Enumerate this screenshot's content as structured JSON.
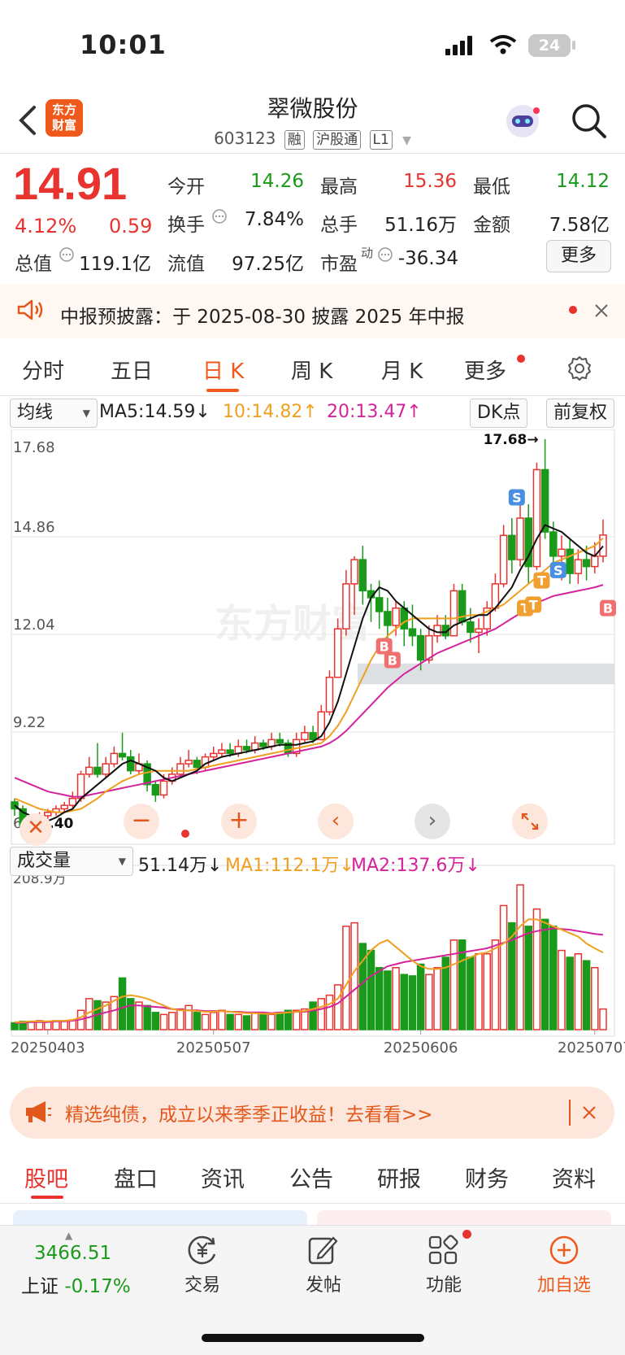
{
  "status_bar": {
    "time": "10:01",
    "battery": "24"
  },
  "header": {
    "logo_text_line1": "东方",
    "logo_text_line2": "财富",
    "stock_name": "翠微股份",
    "stock_code": "603123",
    "tags": [
      "融",
      "沪股通",
      "L1"
    ]
  },
  "quote": {
    "price": "14.91",
    "change_pct": "4.12%",
    "change": "0.59",
    "stats": [
      {
        "label": "今开",
        "value": "14.26",
        "color": "green"
      },
      {
        "label": "最高",
        "value": "15.36",
        "color": "red"
      },
      {
        "label": "最低",
        "value": "14.12",
        "color": "green"
      },
      {
        "label": "换手",
        "value": "7.84%",
        "color": "black"
      },
      {
        "label": "总手",
        "value": "51.16万",
        "color": "black"
      },
      {
        "label": "金额",
        "value": "7.58亿",
        "color": "black"
      },
      {
        "label": "总值",
        "value": "119.1亿",
        "color": "black"
      },
      {
        "label": "流值",
        "value": "97.25亿",
        "color": "black"
      },
      {
        "label": "市盈",
        "value": "-36.34",
        "color": "black",
        "superscript": "动"
      }
    ],
    "more_button": "更多"
  },
  "notice": {
    "text": "中报预披露：于 2025-08-30 披露 2025 年中报"
  },
  "chart_tabs": [
    "分时",
    "五日",
    "日 K",
    "周 K",
    "月 K",
    "更多"
  ],
  "active_chart_tab": "日 K",
  "ma_bar": {
    "selector": "均线",
    "ma5": "MA5:14.59",
    "ma10": "10:14.82",
    "ma20": "20:13.47",
    "dk_button": "DK点",
    "adjust_button": "前复权",
    "arrow_down": "↓",
    "arrow_up": "↑"
  },
  "volume_bar": {
    "selector": "成交量",
    "value": "51.14万",
    "ma1": "MA1:112.1万",
    "ma2": "MA2:137.6万",
    "arrow": "↓"
  },
  "chart_data": {
    "type": "candlestick",
    "price_axis_ticks": [
      "17.68",
      "14.86",
      "12.04",
      "9.22",
      "6.40"
    ],
    "ylim": [
      6.4,
      17.68
    ],
    "max_label": "17.68",
    "min_label": "6.40",
    "x_ticks": [
      "20250403",
      "20250507",
      "20250606",
      "20250707"
    ],
    "volume_axis_label": "208.9万",
    "candles": [
      [
        7.2,
        7.0,
        7.3,
        6.8
      ],
      [
        7.0,
        6.5,
        7.1,
        6.4
      ],
      [
        6.5,
        6.6,
        6.8,
        6.45
      ],
      [
        6.6,
        6.8,
        6.9,
        6.5
      ],
      [
        6.8,
        6.9,
        7.0,
        6.7
      ],
      [
        6.9,
        7.0,
        7.1,
        6.8
      ],
      [
        7.0,
        7.1,
        7.2,
        6.9
      ],
      [
        7.1,
        7.3,
        7.5,
        7.0
      ],
      [
        7.3,
        8.0,
        8.1,
        7.2
      ],
      [
        8.0,
        8.2,
        8.5,
        7.9
      ],
      [
        8.2,
        8.0,
        8.9,
        7.9
      ],
      [
        8.0,
        8.3,
        8.5,
        7.9
      ],
      [
        8.3,
        8.6,
        8.8,
        8.2
      ],
      [
        8.6,
        8.5,
        9.2,
        8.4
      ],
      [
        8.5,
        8.1,
        8.7,
        8.0
      ],
      [
        8.1,
        8.3,
        8.6,
        8.0
      ],
      [
        8.3,
        7.7,
        8.4,
        7.5
      ],
      [
        7.7,
        7.4,
        7.8,
        7.2
      ],
      [
        7.4,
        7.8,
        8.0,
        7.3
      ],
      [
        7.8,
        8.0,
        8.2,
        7.7
      ],
      [
        8.0,
        8.3,
        8.5,
        7.9
      ],
      [
        8.3,
        8.4,
        8.7,
        8.2
      ],
      [
        8.4,
        8.2,
        8.5,
        8.0
      ],
      [
        8.2,
        8.5,
        8.6,
        8.1
      ],
      [
        8.5,
        8.6,
        8.8,
        8.4
      ],
      [
        8.6,
        8.7,
        8.9,
        8.5
      ],
      [
        8.7,
        8.6,
        8.9,
        8.5
      ],
      [
        8.6,
        8.8,
        9.0,
        8.5
      ],
      [
        8.8,
        8.7,
        9.0,
        8.6
      ],
      [
        8.7,
        8.9,
        9.1,
        8.6
      ],
      [
        8.9,
        8.8,
        9.0,
        8.7
      ],
      [
        8.8,
        9.0,
        9.2,
        8.7
      ],
      [
        9.0,
        8.9,
        9.2,
        8.8
      ],
      [
        8.9,
        8.6,
        9.0,
        8.5
      ],
      [
        8.6,
        9.0,
        9.2,
        8.5
      ],
      [
        9.0,
        9.2,
        9.4,
        8.9
      ],
      [
        9.2,
        9.0,
        9.4,
        8.9
      ],
      [
        9.0,
        9.8,
        10.0,
        9.0
      ],
      [
        9.8,
        10.8,
        11.0,
        9.7
      ],
      [
        10.8,
        12.2,
        12.5,
        10.8
      ],
      [
        12.2,
        13.5,
        13.9,
        12.0
      ],
      [
        13.5,
        14.2,
        14.3,
        12.6
      ],
      [
        14.2,
        13.3,
        14.6,
        12.9
      ],
      [
        13.3,
        13.1,
        13.5,
        12.4
      ],
      [
        13.1,
        12.7,
        13.6,
        12.2
      ],
      [
        12.7,
        12.3,
        13.1,
        11.8
      ],
      [
        12.3,
        12.8,
        13.0,
        12.0
      ],
      [
        12.8,
        12.2,
        13.0,
        11.7
      ],
      [
        12.2,
        12.0,
        12.9,
        11.7
      ],
      [
        12.0,
        11.3,
        12.2,
        11.0
      ],
      [
        11.3,
        12.0,
        12.3,
        11.2
      ],
      [
        12.0,
        12.3,
        12.6,
        11.8
      ],
      [
        12.3,
        12.0,
        12.6,
        11.9
      ],
      [
        12.0,
        13.3,
        13.5,
        12.0
      ],
      [
        13.3,
        12.4,
        13.5,
        12.3
      ],
      [
        12.4,
        12.1,
        12.8,
        11.8
      ],
      [
        12.1,
        12.2,
        12.5,
        11.5
      ],
      [
        12.2,
        12.8,
        13.0,
        12.0
      ],
      [
        12.8,
        13.5,
        13.8,
        12.7
      ],
      [
        13.5,
        14.9,
        15.2,
        13.4
      ],
      [
        14.9,
        14.2,
        15.4,
        13.8
      ],
      [
        14.2,
        15.4,
        16.0,
        14.0
      ],
      [
        15.4,
        14.0,
        15.8,
        13.5
      ],
      [
        14.0,
        16.8,
        17.0,
        13.9
      ],
      [
        16.8,
        15.0,
        17.68,
        14.8
      ],
      [
        15.0,
        14.3,
        15.3,
        14.1
      ],
      [
        14.3,
        14.5,
        14.9,
        13.6
      ],
      [
        14.5,
        13.8,
        14.8,
        13.5
      ],
      [
        13.8,
        14.2,
        14.5,
        13.5
      ],
      [
        14.2,
        14.0,
        14.6,
        13.6
      ],
      [
        14.0,
        14.3,
        14.7,
        13.8
      ],
      [
        14.3,
        14.91,
        15.36,
        14.12
      ]
    ],
    "volumes": [
      10,
      12,
      12,
      13,
      12,
      13,
      13,
      14,
      28,
      45,
      42,
      40,
      48,
      75,
      45,
      40,
      35,
      25,
      22,
      25,
      30,
      35,
      25,
      22,
      25,
      28,
      22,
      22,
      20,
      25,
      23,
      22,
      25,
      28,
      28,
      30,
      40,
      45,
      50,
      65,
      150,
      155,
      125,
      115,
      90,
      85,
      90,
      80,
      78,
      95,
      80,
      90,
      105,
      130,
      130,
      105,
      110,
      110,
      130,
      180,
      155,
      210,
      150,
      175,
      160,
      150,
      115,
      105,
      110,
      100,
      90,
      30
    ],
    "ma1_series": [
      11,
      11,
      12,
      12,
      12,
      13,
      13,
      14,
      18,
      25,
      30,
      35,
      42,
      48,
      50,
      48,
      45,
      40,
      35,
      30,
      28,
      28,
      27,
      26,
      26,
      27,
      26,
      25,
      24,
      24,
      23,
      23,
      24,
      25,
      26,
      27,
      30,
      33,
      37,
      45,
      65,
      85,
      100,
      115,
      125,
      130,
      120,
      110,
      100,
      92,
      88,
      88,
      90,
      95,
      100,
      105,
      110,
      112,
      118,
      125,
      135,
      150,
      160,
      160,
      155,
      150,
      145,
      140,
      135,
      125,
      118,
      112
    ],
    "ma2_series": [
      10,
      10,
      11,
      11,
      11,
      12,
      12,
      13,
      15,
      18,
      22,
      25,
      28,
      32,
      35,
      35,
      34,
      33,
      32,
      30,
      29,
      28,
      28,
      27,
      27,
      27,
      26,
      26,
      25,
      25,
      25,
      24,
      25,
      25,
      26,
      26,
      28,
      30,
      33,
      38,
      48,
      58,
      68,
      78,
      85,
      92,
      95,
      98,
      100,
      102,
      104,
      106,
      108,
      110,
      112,
      114,
      116,
      118,
      122,
      126,
      130,
      135,
      140,
      143,
      145,
      147,
      146,
      145,
      143,
      141,
      139,
      137.6
    ],
    "ma5": [
      7.1,
      6.9,
      6.8,
      6.7,
      6.65,
      6.75,
      6.9,
      7.0,
      7.3,
      7.5,
      7.7,
      7.9,
      8.1,
      8.3,
      8.4,
      8.3,
      8.2,
      8.1,
      7.9,
      7.8,
      7.9,
      8.0,
      8.1,
      8.3,
      8.4,
      8.5,
      8.55,
      8.6,
      8.65,
      8.7,
      8.75,
      8.8,
      8.85,
      8.85,
      8.85,
      8.9,
      8.95,
      9.1,
      9.5,
      10.1,
      10.9,
      11.7,
      12.5,
      13.1,
      13.4,
      13.3,
      13.0,
      12.8,
      12.6,
      12.4,
      12.2,
      12.1,
      12.1,
      12.3,
      12.4,
      12.5,
      12.6,
      12.6,
      12.8,
      13.1,
      13.4,
      13.9,
      14.3,
      14.8,
      15.2,
      15.1,
      15.0,
      14.8,
      14.6,
      14.4,
      14.3,
      14.59
    ],
    "ma10": [
      7.3,
      7.2,
      7.1,
      7.0,
      6.95,
      6.9,
      6.9,
      6.95,
      7.0,
      7.15,
      7.3,
      7.5,
      7.65,
      7.8,
      7.9,
      8.0,
      8.05,
      8.1,
      8.1,
      8.1,
      8.1,
      8.1,
      8.15,
      8.2,
      8.25,
      8.3,
      8.35,
      8.4,
      8.45,
      8.5,
      8.55,
      8.6,
      8.65,
      8.7,
      8.75,
      8.8,
      8.85,
      8.9,
      9.1,
      9.4,
      9.8,
      10.3,
      10.8,
      11.3,
      11.7,
      12.0,
      12.2,
      12.4,
      12.5,
      12.5,
      12.5,
      12.5,
      12.5,
      12.5,
      12.55,
      12.6,
      12.6,
      12.7,
      12.8,
      12.9,
      13.1,
      13.3,
      13.5,
      13.7,
      13.9,
      14.1,
      14.2,
      14.3,
      14.4,
      14.5,
      14.6,
      14.82
    ],
    "ma20": [
      7.9,
      7.8,
      7.7,
      7.6,
      7.5,
      7.45,
      7.4,
      7.35,
      7.35,
      7.4,
      7.45,
      7.5,
      7.55,
      7.6,
      7.65,
      7.7,
      7.75,
      7.8,
      7.85,
      7.9,
      7.95,
      8.0,
      8.05,
      8.1,
      8.15,
      8.2,
      8.25,
      8.3,
      8.35,
      8.4,
      8.45,
      8.5,
      8.55,
      8.6,
      8.65,
      8.7,
      8.75,
      8.8,
      8.9,
      9.05,
      9.25,
      9.5,
      9.75,
      10.0,
      10.25,
      10.5,
      10.7,
      10.9,
      11.05,
      11.2,
      11.35,
      11.5,
      11.6,
      11.7,
      11.8,
      11.9,
      12.0,
      12.1,
      12.2,
      12.35,
      12.5,
      12.65,
      12.8,
      12.95,
      13.05,
      13.15,
      13.2,
      13.25,
      13.3,
      13.35,
      13.4,
      13.47
    ],
    "markers": [
      {
        "text": "B",
        "index": 44,
        "price": 11.7,
        "color": "#f07070"
      },
      {
        "text": "B",
        "index": 45,
        "price": 11.3,
        "color": "#f07070"
      },
      {
        "text": "S",
        "index": 60,
        "price": 16.0,
        "color": "#4a90e2"
      },
      {
        "text": "S",
        "index": 65,
        "price": 13.9,
        "color": "#4a90e2"
      },
      {
        "text": "T",
        "index": 61,
        "price": 12.8,
        "color": "#f0a030"
      },
      {
        "text": "T",
        "index": 62,
        "price": 12.9,
        "color": "#f0a030"
      },
      {
        "text": "T",
        "index": 63,
        "price": 13.6,
        "color": "#f0a030"
      },
      {
        "text": "B",
        "index": 71,
        "price": 12.8,
        "color": "#f07070"
      }
    ],
    "watermark": "东方财富"
  },
  "promo": {
    "text": "精选纯债，成立以来季季正收益！去看看>>"
  },
  "bottom_tabs": [
    "股吧",
    "盘口",
    "资讯",
    "公告",
    "研报",
    "财务",
    "资料"
  ],
  "active_bottom_tab": "股吧",
  "bottom_nav": {
    "index_value": "3466.51",
    "index_name": "上证",
    "index_change": "-0.17%",
    "items": [
      "交易",
      "发帖",
      "功能",
      "加自选"
    ]
  }
}
